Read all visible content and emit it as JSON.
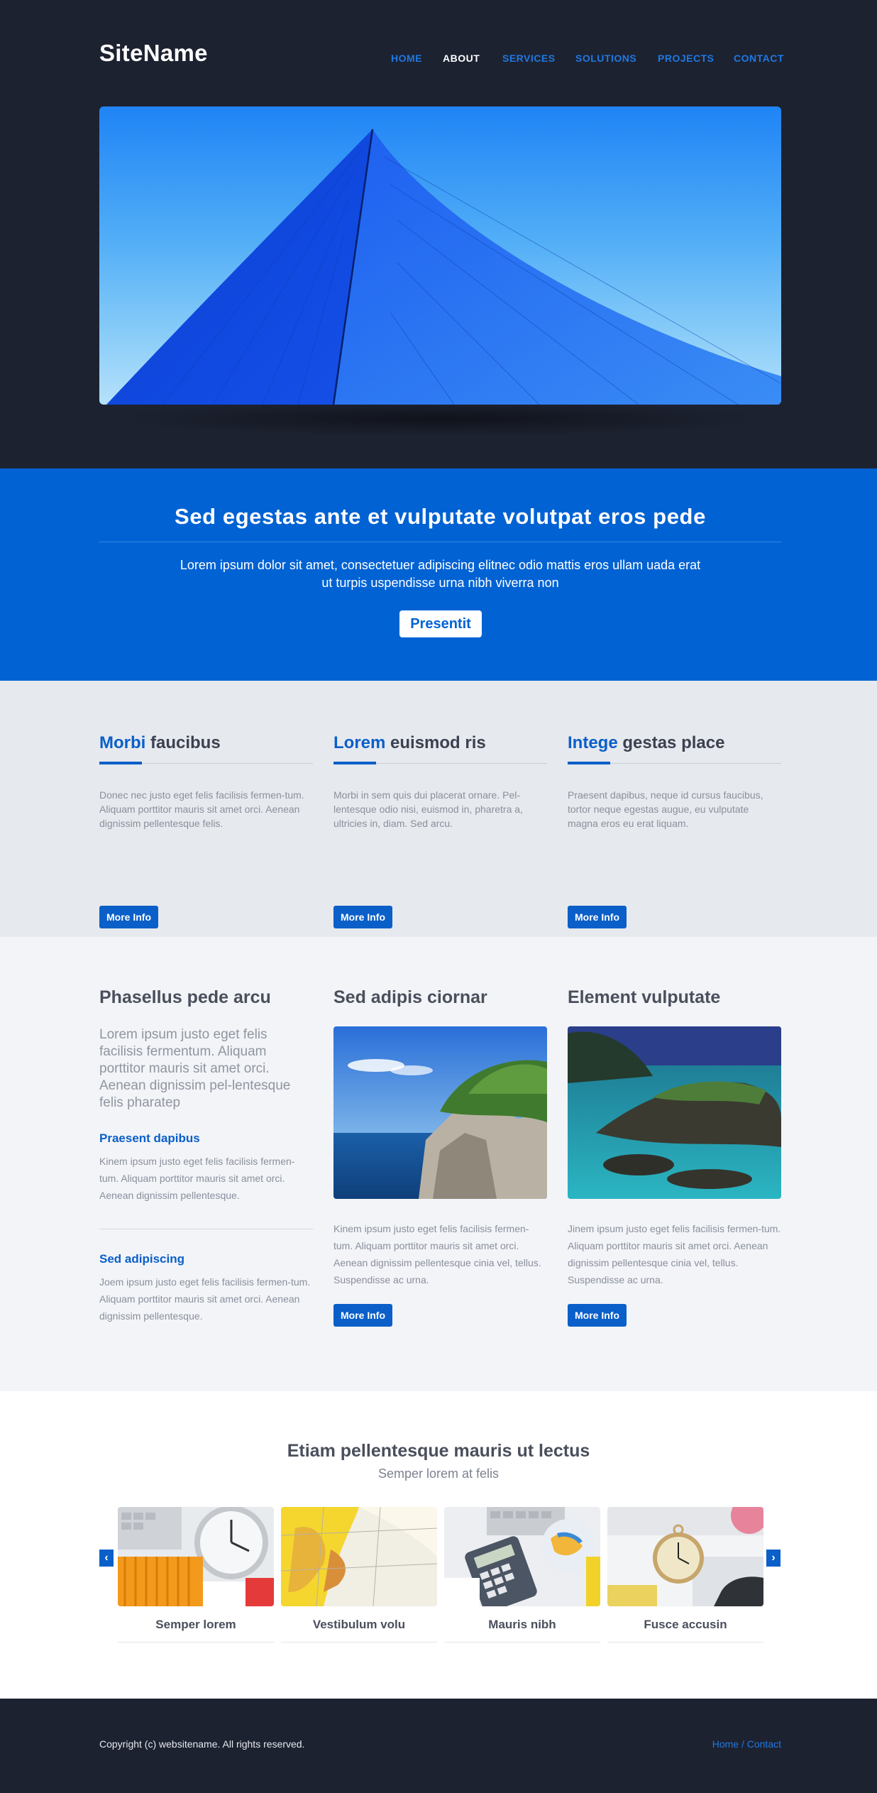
{
  "header": {
    "logo": "SiteName",
    "nav": [
      {
        "label": "HOME",
        "active": false
      },
      {
        "label": "ABOUT",
        "active": true
      },
      {
        "label": "SERVICES",
        "active": false
      },
      {
        "label": "SOLUTIONS",
        "active": false
      },
      {
        "label": "PROJECTS",
        "active": false
      },
      {
        "label": "CONTACT",
        "active": false
      }
    ]
  },
  "banner": {
    "title": "Sed egestas ante et vulputate volutpat eros pede",
    "text": "Lorem ipsum dolor sit amet, consectetuer adipiscing elitnec odio mattis eros ullam uada erat ut turpis uspendisse urna nibh  viverra non",
    "button": "Presentit"
  },
  "features": [
    {
      "title_highlight": "Morbi",
      "title_rest": " faucibus",
      "text": "Donec nec justo eget felis facilisis fermen-tum. Aliquam porttitor mauris sit amet orci. Aenean dignissim pellentesque felis.",
      "button": "More Info"
    },
    {
      "title_highlight": "Lorem",
      "title_rest": "  euismod ris",
      "text": "Morbi in sem quis dui placerat ornare. Pel-lentesque odio nisi, euismod in, pharetra a, ultricies in, diam. Sed arcu.",
      "button": "More Info"
    },
    {
      "title_highlight": "Intege",
      "title_rest": "  gestas place",
      "text": "Praesent dapibus, neque id cursus faucibus, tortor neque egestas augue, eu vulputate magna eros eu erat  liquam.",
      "button": "More Info"
    }
  ],
  "content": {
    "col1": {
      "title": "Phasellus pede arcu",
      "lead": "Lorem ipsum justo eget felis facilisis fermentum. Aliquam porttitor mauris sit amet orci. Aenean dignissim pel-lentesque felis pharatep",
      "sub1_title": "Praesent dapibus",
      "sub1_text": "Kinem ipsum justo eget felis facilisis fermen-tum. Aliquam porttitor mauris sit amet orci. Aenean dignissim pellentesque.",
      "sub2_title": "Sed adipiscing",
      "sub2_text": "Joem ipsum justo eget felis facilisis fermen-tum. Aliquam porttitor mauris sit amet orci. Aenean dignissim pellentesque."
    },
    "col2": {
      "title": "Sed adipis ciornar",
      "text": "Kinem ipsum justo eget felis facilisis fermen-tum. Aliquam porttitor mauris sit amet orci. Aenean dignissim pellentesque cinia vel, tellus. Suspendisse ac urna.",
      "button": "More Info"
    },
    "col3": {
      "title": "Element  vulputate",
      "text": "Jinem ipsum justo eget felis facilisis fermen-tum. Aliquam porttitor mauris sit amet orci. Aenean dignissim pellentesque cinia vel, tellus. Suspendisse ac urna.",
      "button": "More Info"
    }
  },
  "carousel": {
    "title": "Etiam pellentesque mauris ut lectus",
    "subtitle": "Semper lorem at felis",
    "items": [
      {
        "caption": "Semper lorem",
        "icon": "clock-image"
      },
      {
        "caption": "Vestibulum volu",
        "icon": "map-image"
      },
      {
        "caption": "Mauris nibh",
        "icon": "calculator-image"
      },
      {
        "caption": "Fusce accusin",
        "icon": "pocket-watch-image"
      }
    ],
    "prev": "‹",
    "next": "›"
  },
  "footer": {
    "copyright": "Copyright (c) websitename. All rights reserved.",
    "link_home": "Home",
    "separator": " / ",
    "link_contact": "Contact"
  },
  "colors": {
    "dark": "#1d2231",
    "accent": "#0162d3",
    "link": "#1f78e0",
    "light_gray": "#e6e9ee"
  }
}
